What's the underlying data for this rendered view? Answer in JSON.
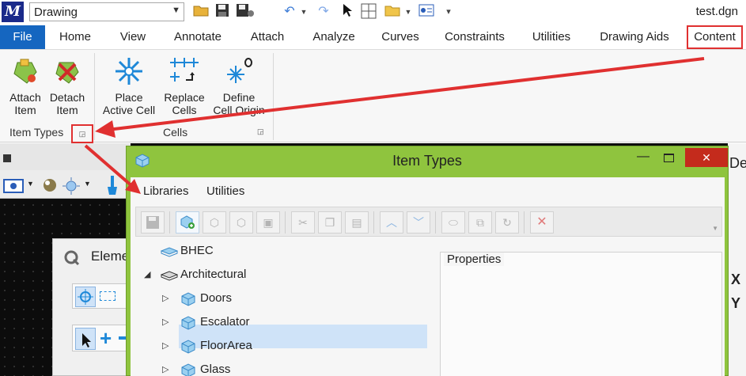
{
  "quick_access": {
    "workflow": "Drawing",
    "file_title": "test.dgn",
    "icons": [
      "open-folder-icon",
      "save-icon",
      "save-settings-icon",
      "undo-icon",
      "redo-icon",
      "select-cursor-icon",
      "key-in-icon",
      "open-folder-icon",
      "properties-icon",
      "customize-icon"
    ]
  },
  "ribbon_tabs": [
    "File",
    "Home",
    "View",
    "Annotate",
    "Attach",
    "Analyze",
    "Curves",
    "Constraints",
    "Utilities",
    "Drawing Aids",
    "Content"
  ],
  "ribbon": {
    "groups": [
      {
        "label": "Item Types",
        "buttons": [
          {
            "line1": "Attach",
            "line2": "Item",
            "icon": "attach-item-icon"
          },
          {
            "line1": "Detach",
            "line2": "Item",
            "icon": "detach-item-icon"
          }
        ]
      },
      {
        "label": "Cells",
        "buttons": [
          {
            "line1": "Place",
            "line2": "Active Cell",
            "icon": "place-active-cell-icon"
          },
          {
            "line1": "Replace",
            "line2": "Cells",
            "icon": "replace-cells-icon"
          },
          {
            "line1": "Define",
            "line2": "Cell Origin",
            "icon": "define-cell-origin-icon"
          }
        ]
      }
    ]
  },
  "background": {
    "element_dialog_title": "Eleme",
    "right_edge_text": "De",
    "coord_labels": [
      "X",
      "Y"
    ]
  },
  "item_types_dialog": {
    "title": "Item Types",
    "menu": [
      "Libraries",
      "Utilities"
    ],
    "toolbar_icons": [
      "save-icon",
      "new-library-icon",
      "new-item-type-icon",
      "new-property-icon",
      "import-icon",
      "cut-icon",
      "copy-icon",
      "paste-icon",
      "move-up-icon",
      "move-down-icon",
      "rename-icon",
      "duplicate-icon",
      "refresh-icon",
      "delete-icon"
    ],
    "tree": [
      {
        "label": "BHEC",
        "level": 0,
        "expander": "",
        "selected": false
      },
      {
        "label": "Architectural",
        "level": 0,
        "expander": "expanded",
        "selected": false
      },
      {
        "label": "Doors",
        "level": 1,
        "expander": "collapsed",
        "selected": false
      },
      {
        "label": "Escalator",
        "level": 1,
        "expander": "collapsed",
        "selected": true
      },
      {
        "label": "FloorArea",
        "level": 1,
        "expander": "collapsed",
        "selected": false
      },
      {
        "label": "Glass",
        "level": 1,
        "expander": "collapsed",
        "selected": false
      }
    ],
    "properties_label": "Properties"
  },
  "colors": {
    "file_tab": "#1566c0",
    "dialog_frame": "#8fc43e",
    "annotation_red": "#e03030",
    "selection": "#cfe3f8",
    "close_button": "#c42b1c"
  }
}
